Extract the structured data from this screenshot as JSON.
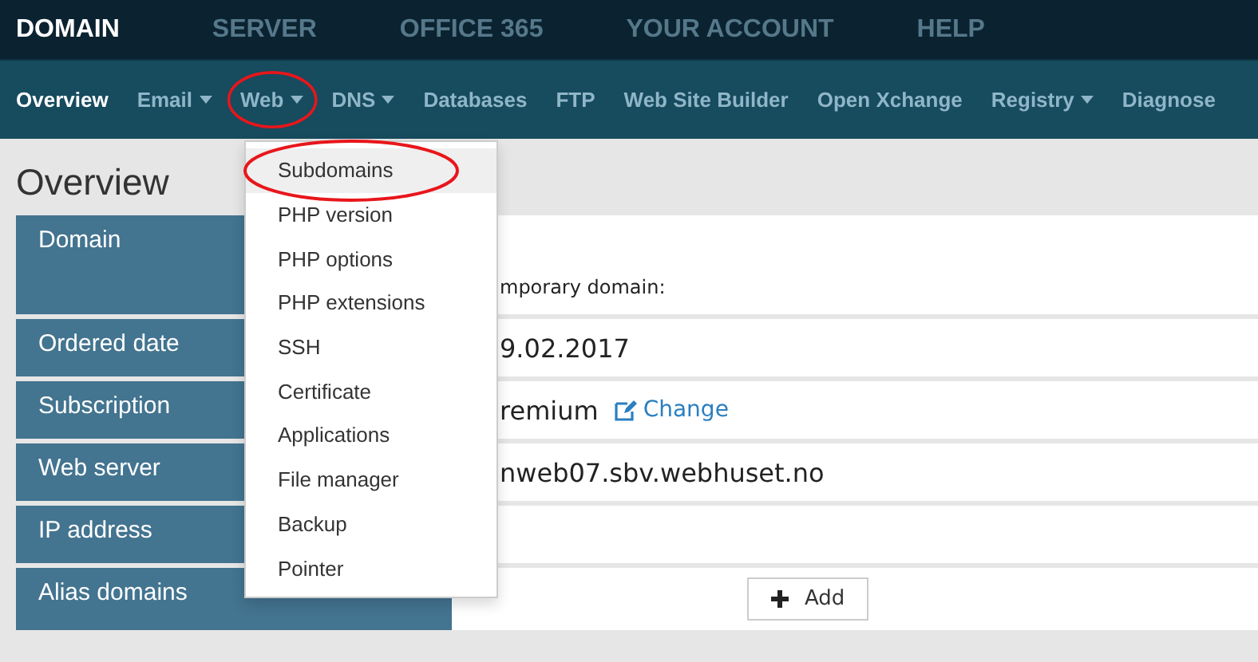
{
  "top_nav": [
    {
      "label": "DOMAIN",
      "selected": true
    },
    {
      "label": "SERVER",
      "selected": false
    },
    {
      "label": "OFFICE 365",
      "selected": false
    },
    {
      "label": "YOUR ACCOUNT",
      "selected": false
    },
    {
      "label": "HELP",
      "selected": false
    }
  ],
  "sub_nav": [
    {
      "label": "Overview",
      "selected": true,
      "dropdown": false,
      "circled": false
    },
    {
      "label": "Email",
      "selected": false,
      "dropdown": true,
      "circled": false
    },
    {
      "label": "Web",
      "selected": false,
      "dropdown": true,
      "circled": true
    },
    {
      "label": "DNS",
      "selected": false,
      "dropdown": true,
      "circled": false
    },
    {
      "label": "Databases",
      "selected": false,
      "dropdown": false,
      "circled": false
    },
    {
      "label": "FTP",
      "selected": false,
      "dropdown": false,
      "circled": false
    },
    {
      "label": "Web Site Builder",
      "selected": false,
      "dropdown": false,
      "circled": false
    },
    {
      "label": "Open Xchange",
      "selected": false,
      "dropdown": false,
      "circled": false
    },
    {
      "label": "Registry",
      "selected": false,
      "dropdown": true,
      "circled": false
    },
    {
      "label": "Diagnose",
      "selected": false,
      "dropdown": false,
      "circled": false
    }
  ],
  "page_title": "Overview",
  "rows": [
    {
      "label": "Domain",
      "kind": "lines",
      "lines": [
        "mporary domain:"
      ]
    },
    {
      "label": "Ordered date",
      "kind": "text",
      "value": "9.02.2017"
    },
    {
      "label": "Subscription",
      "kind": "link",
      "value": "remium",
      "link": "Change"
    },
    {
      "label": "Web server",
      "kind": "text",
      "value": "nweb07.sbv.webhuset.no"
    },
    {
      "label": "IP address",
      "kind": "empty"
    },
    {
      "label": "Alias domains",
      "kind": "button",
      "button": "Add"
    }
  ],
  "dropdown": [
    {
      "label": "Subdomains",
      "selected": true,
      "circled": true
    },
    {
      "label": "PHP version",
      "selected": false,
      "circled": false
    },
    {
      "label": "PHP options",
      "selected": false,
      "circled": false
    },
    {
      "label": "PHP extensions",
      "selected": false,
      "circled": false
    },
    {
      "label": "SSH",
      "selected": false,
      "circled": false
    },
    {
      "label": "Certificate",
      "selected": false,
      "circled": false
    },
    {
      "label": "Applications",
      "selected": false,
      "circled": false
    },
    {
      "label": "File manager",
      "selected": false,
      "circled": false
    },
    {
      "label": "Backup",
      "selected": false,
      "circled": false
    },
    {
      "label": "Pointer",
      "selected": false,
      "circled": false
    }
  ]
}
